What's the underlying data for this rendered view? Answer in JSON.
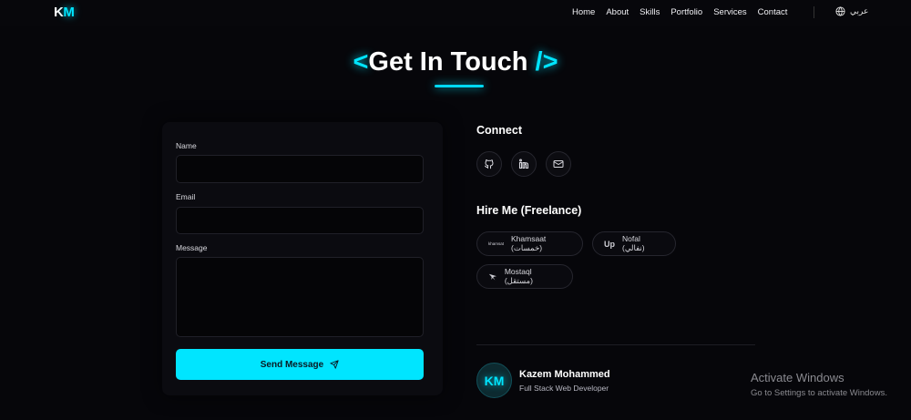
{
  "nav": {
    "logo_k": "K",
    "logo_m": "M",
    "links": [
      "Home",
      "About",
      "Skills",
      "Portfolio",
      "Services",
      "Contact"
    ],
    "language": "عربي",
    "language_icon": "globe-icon"
  },
  "heading": {
    "open_bracket": "<",
    "title": "Get In Touch",
    "close_bracket": "/>"
  },
  "form": {
    "name_label": "Name",
    "email_label": "Email",
    "message_label": "Message",
    "name_value": "",
    "email_value": "",
    "message_value": "",
    "send_label": "Send Message",
    "send_icon": "send-icon"
  },
  "connect": {
    "title": "Connect",
    "icons": [
      "github-icon",
      "linkedin-icon",
      "mail-icon"
    ]
  },
  "hire": {
    "title": "Hire Me (Freelance)",
    "platforms": [
      {
        "icon_text": "khamsat",
        "label": "Khamsaat (خمسات)"
      },
      {
        "icon_text": "Up",
        "label": "Nofal (نفالي)"
      },
      {
        "icon_text": "mostaql-icon",
        "label": "Mostaql (مستقل)"
      }
    ]
  },
  "profile": {
    "initials": "KM",
    "name": "Kazem Mohammed",
    "role": "Full Stack Web Developer"
  },
  "watermark": {
    "title": "Activate Windows",
    "subtitle": "Go to Settings to activate Windows."
  },
  "colors": {
    "accent": "#00e5ff",
    "background": "#06060a",
    "card": "#0b0b10"
  }
}
